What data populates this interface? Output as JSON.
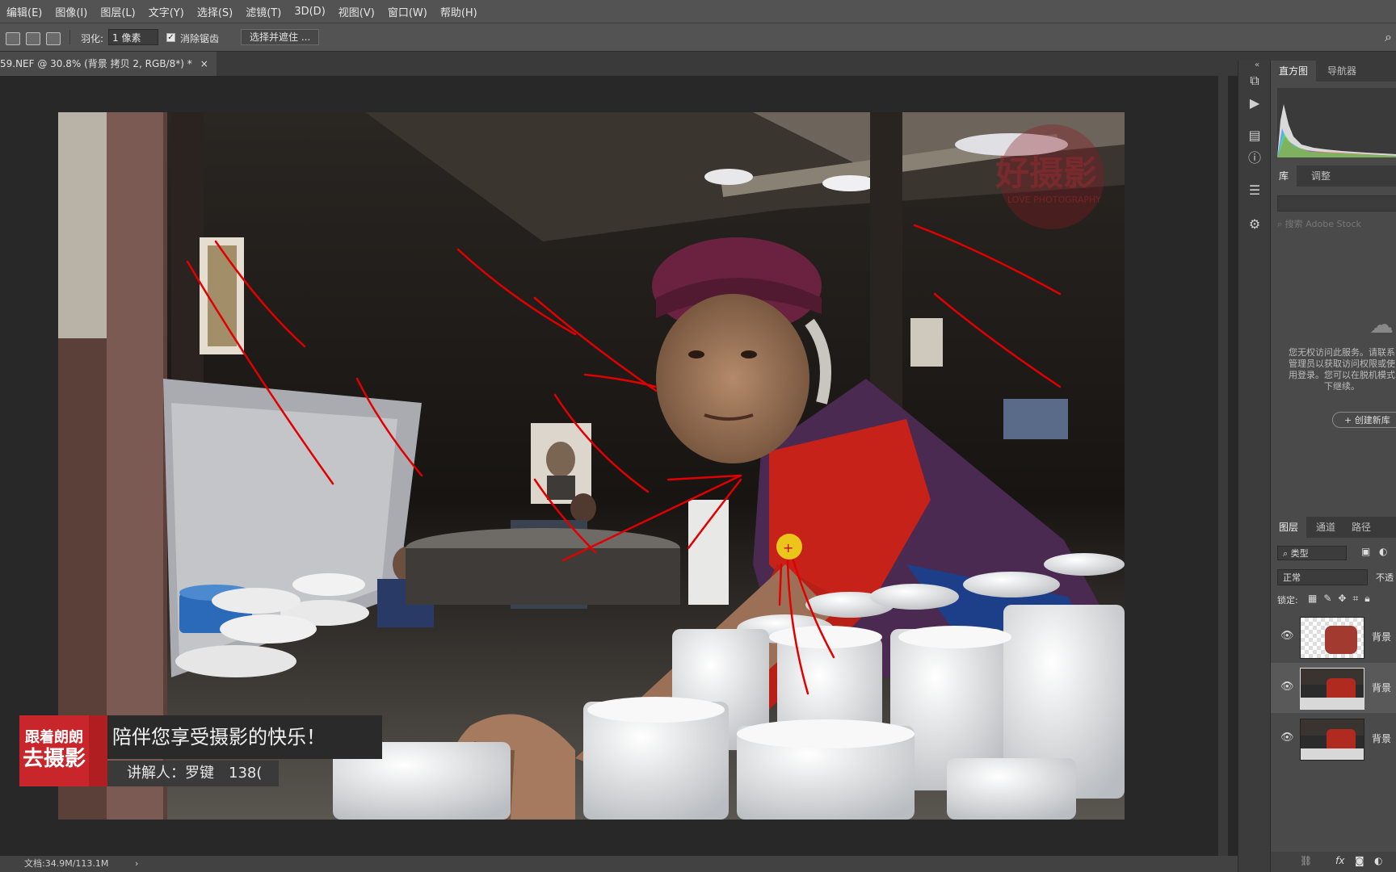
{
  "menu": [
    "编辑(E)",
    "图像(I)",
    "图层(L)",
    "文字(Y)",
    "选择(S)",
    "滤镜(T)",
    "3D(D)",
    "视图(V)",
    "窗口(W)",
    "帮助(H)"
  ],
  "options": {
    "feather_label": "羽化:",
    "feather_value": "1 像素",
    "antialias_label": "消除锯齿",
    "antialias_checked": "✓",
    "select_mask_button": "选择并遮住 ..."
  },
  "document": {
    "tab_title": "59.NEF @ 30.8% (背景 拷贝 2, RGB/8*) *",
    "close": "×"
  },
  "status": {
    "doc_size": "文档:34.9M/113.1M",
    "arrow": "›"
  },
  "panels": {
    "top_tabs": [
      "直方图",
      "导航器"
    ],
    "mid_tabs": [
      "库",
      "调整"
    ],
    "search_placeholder": "搜索 Adobe Stock",
    "cc_message": "您无权访问此服务。请联系管理员以获取访问权限或使用登录。您可以在脱机模式下继续。",
    "create_button": "+ 创建新库",
    "layer_tabs": [
      "图层",
      "通道",
      "路径"
    ],
    "filter_label": "类型",
    "blend_mode": "正常",
    "opacity_label": "不透",
    "lock_label": "锁定:",
    "layers": [
      {
        "name": "背景"
      },
      {
        "name": "背景"
      },
      {
        "name": "背景"
      }
    ],
    "bottom_icons": [
      "fx"
    ]
  },
  "overlay": {
    "brand_line1": "跟着朗朗",
    "brand_line2": "去摄影",
    "slogan": "陪伴您享受摄影的快乐！",
    "speaker": "讲解人：罗键　138(",
    "watermark_main": "好摄影",
    "watermark_sub": "LOVE PHOTOGRAPHY"
  },
  "colors": {
    "ui_dark": "#282828",
    "menubar": "#535353",
    "brand_red": "#c8262a",
    "annotation_red": "#e00000"
  }
}
